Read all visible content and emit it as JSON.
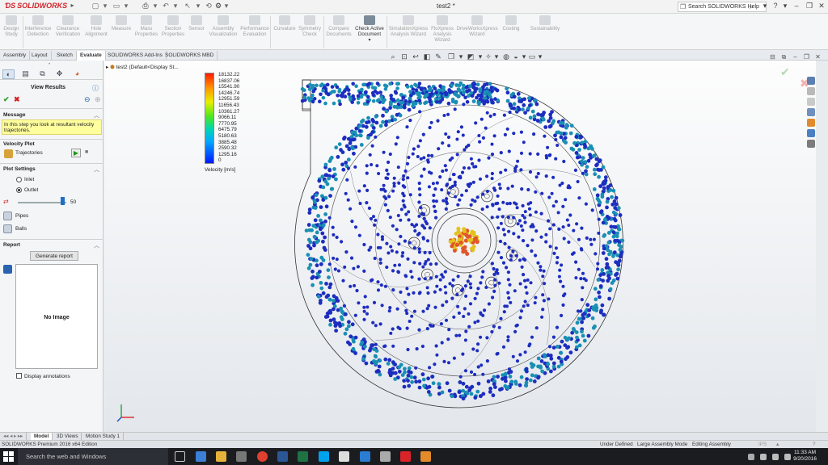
{
  "app": {
    "logo_text": "SOLIDWORKS",
    "document_title": "test2 *",
    "help_search_label": "Search SOLIDWORKS Help",
    "window_controls": [
      "?",
      "–",
      "❐",
      "✕"
    ]
  },
  "ribbon": {
    "buttons": [
      {
        "label": "Design Study",
        "enabled": false
      },
      {
        "label": "Interference Detection",
        "enabled": false
      },
      {
        "label": "Clearance Verification",
        "enabled": false
      },
      {
        "label": "Hole Alignment",
        "enabled": false
      },
      {
        "label": "Measure",
        "enabled": false
      },
      {
        "label": "Mass Properties",
        "enabled": false
      },
      {
        "label": "Section Properties",
        "enabled": false
      },
      {
        "label": "Sensor",
        "enabled": false
      },
      {
        "label": "Assembly Visualization",
        "enabled": false
      },
      {
        "label": "Performance Evaluation",
        "enabled": false
      },
      {
        "label": "Curvature",
        "enabled": false
      },
      {
        "label": "Symmetry Check",
        "enabled": false
      },
      {
        "label": "Compare Documents",
        "enabled": false
      },
      {
        "label": "Check Active Document",
        "enabled": true
      },
      {
        "label": "SimulationXpress Analysis Wizard",
        "enabled": false
      },
      {
        "label": "FloXpress Analysis Wizard",
        "enabled": false
      },
      {
        "label": "DriveWorksXpress Wizard",
        "enabled": false
      },
      {
        "label": "Costing",
        "enabled": false
      },
      {
        "label": "Sustainability",
        "enabled": false
      }
    ]
  },
  "command_tabs": [
    "Assembly",
    "Layout",
    "Sketch",
    "Evaluate",
    "SOLIDWORKS Add-Ins",
    "SOLIDWORKS MBD"
  ],
  "command_tab_selected": "Evaluate",
  "left_panel": {
    "title": "View Results",
    "message_header": "Message",
    "message_text": "In this step you look at resultant velocity trajectories.",
    "velocity_plot_header": "Velocity Plot",
    "trajectories_label": "Trajectories",
    "plot_settings_header": "Plot Settings",
    "inlet_label": "Inlet",
    "outlet_label": "Outlet",
    "outlet_selected": true,
    "slider_value": "50",
    "slider_fraction": 0.88,
    "pipes_label": "Pipes",
    "balls_label": "Balls",
    "report_header": "Report",
    "generate_report_label": "Generate report",
    "no_image_label": "No Image",
    "display_annotations_label": "Display annotations"
  },
  "viewport": {
    "tree_root": "test2  (Default<Display St...",
    "legend_title": "Velocity [m/s]",
    "legend_values": [
      "18132.22",
      "16837.06",
      "15541.90",
      "14246.74",
      "12951.59",
      "11656.43",
      "10361.27",
      "9066.11",
      "7770.95",
      "6475.79",
      "5180.63",
      "3885.48",
      "2590.32",
      "1295.16",
      "0"
    ],
    "colors": {
      "particle_blue": "#1d2dbf",
      "particle_teal": "#1a8fb4",
      "hub_red": "#e0552a",
      "hub_yellow": "#e4c21e"
    }
  },
  "bottom_tabs": [
    "Model",
    "3D Views",
    "Motion Study 1"
  ],
  "bottom_tab_selected": "Model",
  "status": {
    "product": "SOLIDWORKS Premium 2016 x64 Edition",
    "under_defined": "Under Defined",
    "assembly_mode": "Large Assembly Mode",
    "editing": "Editing Assembly",
    "units": "IPS"
  },
  "taskbar": {
    "search_placeholder": "Search the web and Windows",
    "time": "11:33 AM",
    "date": "9/20/2016"
  }
}
